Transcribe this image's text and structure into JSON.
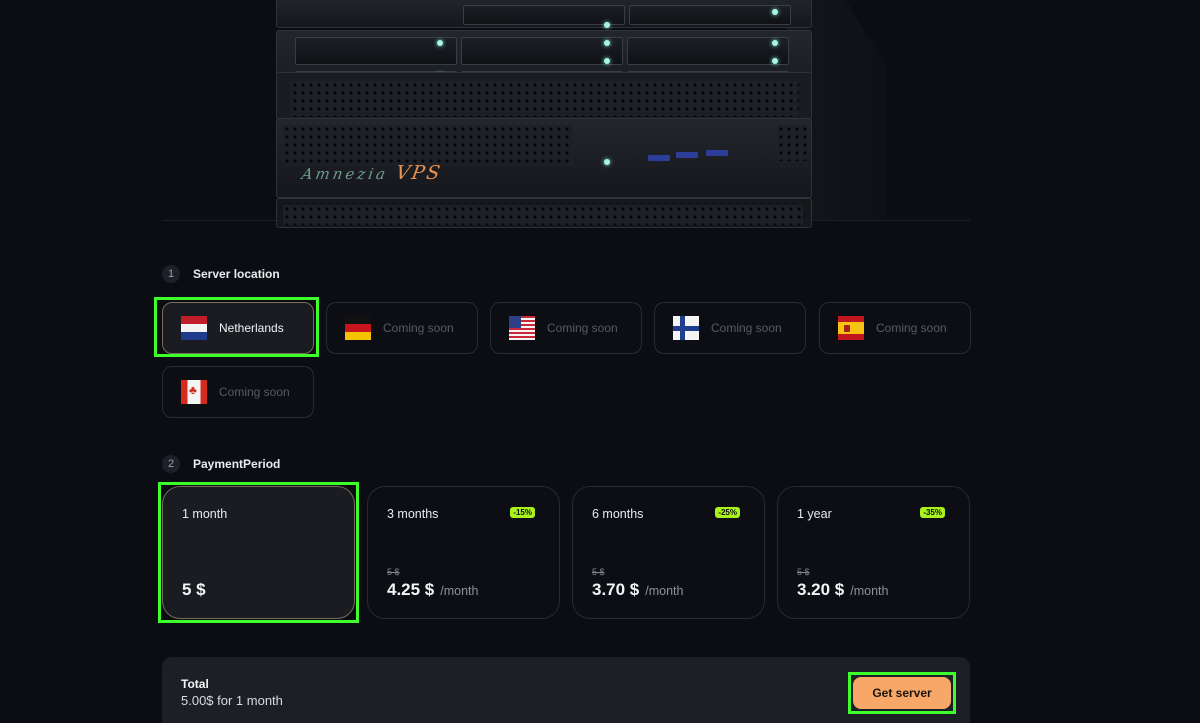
{
  "hero": {
    "brand_text": "Amnezia",
    "brand_suffix": "VPS"
  },
  "location_step": {
    "number": "1",
    "title": "Server location",
    "options": [
      {
        "label": "Netherlands",
        "flag": "netherlands-flag-icon",
        "selected": true
      },
      {
        "label": "Coming soon",
        "flag": "germany-flag-icon",
        "selected": false
      },
      {
        "label": "Coming soon",
        "flag": "usa-flag-icon",
        "selected": false
      },
      {
        "label": "Coming soon",
        "flag": "finland-flag-icon",
        "selected": false
      },
      {
        "label": "Coming soon",
        "flag": "spain-flag-icon",
        "selected": false
      },
      {
        "label": "Coming soon",
        "flag": "canada-flag-icon",
        "selected": false
      }
    ]
  },
  "period_step": {
    "number": "2",
    "title": "PaymentPeriod",
    "options": [
      {
        "name": "1 month",
        "badge": "",
        "old_price": "",
        "price": "5 $",
        "per": "",
        "selected": true
      },
      {
        "name": "3 months",
        "badge": "-15%",
        "old_price": "5 $",
        "price": "4.25 $",
        "per": "/month",
        "selected": false
      },
      {
        "name": "6 months",
        "badge": "-25%",
        "old_price": "5 $",
        "price": "3.70 $",
        "per": "/month",
        "selected": false
      },
      {
        "name": "1 year",
        "badge": "-35%",
        "old_price": "5 $",
        "price": "3.20 $",
        "per": "/month",
        "selected": false
      }
    ]
  },
  "total": {
    "title": "Total",
    "summary": "5.00$ for 1 month",
    "button": "Get server"
  },
  "colors": {
    "accent_button": "#f7a869",
    "discount_badge": "#a9f21c",
    "highlight": "#3cff2b",
    "background": "#0b0d12"
  }
}
